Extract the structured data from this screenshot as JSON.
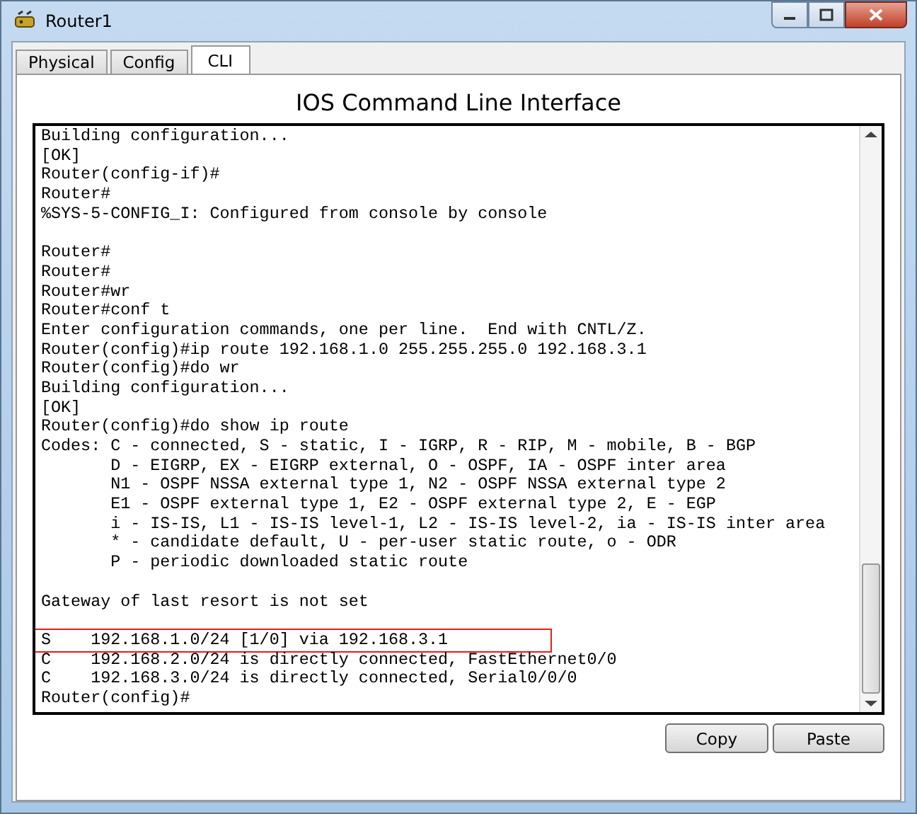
{
  "window": {
    "title": "Router1"
  },
  "tabs": [
    {
      "label": "Physical",
      "selected": false
    },
    {
      "label": "Config",
      "selected": false
    },
    {
      "label": "CLI",
      "selected": true
    }
  ],
  "heading": "IOS Command Line Interface",
  "console": {
    "lines": [
      {
        "text": "Building configuration...",
        "highlighted": false
      },
      {
        "text": "[OK]",
        "highlighted": false
      },
      {
        "text": "Router(config-if)#",
        "highlighted": false
      },
      {
        "text": "Router#",
        "highlighted": false
      },
      {
        "text": "%SYS-5-CONFIG_I: Configured from console by console",
        "highlighted": false
      },
      {
        "highlighted": false
      },
      {
        "text": "Router#",
        "highlighted": false
      },
      {
        "text": "Router#",
        "highlighted": false
      },
      {
        "text": "Router#wr",
        "highlighted": false
      },
      {
        "text": "Router#conf t",
        "highlighted": false
      },
      {
        "text": "Enter configuration commands, one per line.  End with CNTL/Z.",
        "highlighted": false
      },
      {
        "text": "Router(config)#ip route 192.168.1.0 255.255.255.0 192.168.3.1",
        "highlighted": false
      },
      {
        "text": "Router(config)#do wr",
        "highlighted": false
      },
      {
        "text": "Building configuration...",
        "highlighted": false
      },
      {
        "text": "[OK]",
        "highlighted": false
      },
      {
        "text": "Router(config)#do show ip route",
        "highlighted": false
      },
      {
        "text": "Codes: C - connected, S - static, I - IGRP, R - RIP, M - mobile, B - BGP",
        "highlighted": false
      },
      {
        "text": "       D - EIGRP, EX - EIGRP external, O - OSPF, IA - OSPF inter area",
        "highlighted": false
      },
      {
        "text": "       N1 - OSPF NSSA external type 1, N2 - OSPF NSSA external type 2",
        "highlighted": false
      },
      {
        "text": "       E1 - OSPF external type 1, E2 - OSPF external type 2, E - EGP",
        "highlighted": false
      },
      {
        "text": "       i - IS-IS, L1 - IS-IS level-1, L2 - IS-IS level-2, ia - IS-IS inter area",
        "highlighted": false
      },
      {
        "text": "       * - candidate default, U - per-user static route, o - ODR",
        "highlighted": false
      },
      {
        "text": "       P - periodic downloaded static route",
        "highlighted": false
      },
      {
        "highlighted": false
      },
      {
        "text": "Gateway of last resort is not set",
        "highlighted": false
      },
      {
        "highlighted": false
      },
      {
        "text": "S    192.168.1.0/24 [1/0] via 192.168.3.1",
        "highlighted": true
      },
      {
        "text": "C    192.168.2.0/24 is directly connected, FastEthernet0/0",
        "highlighted": false
      },
      {
        "text": "C    192.168.3.0/24 is directly connected, Serial0/0/0",
        "highlighted": false
      },
      {
        "text": "Router(config)#",
        "highlighted": false
      }
    ]
  },
  "buttons": [
    "Copy",
    "Paste"
  ]
}
